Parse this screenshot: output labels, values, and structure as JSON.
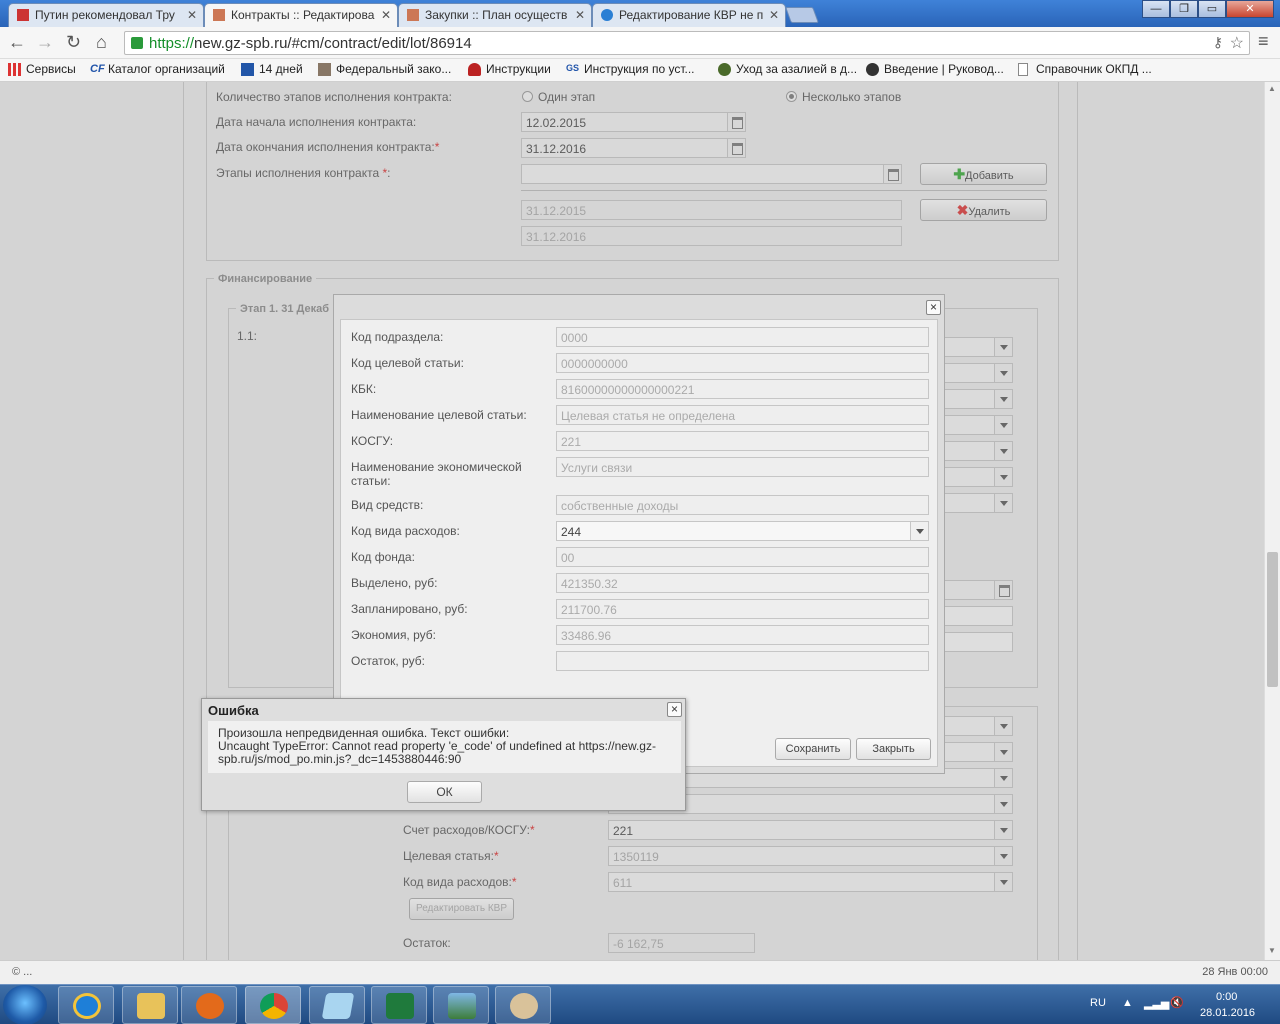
{
  "browser": {
    "tabs": [
      {
        "title": "Путин рекомендовал Тру",
        "favicon": "news-icon",
        "active": false
      },
      {
        "title": "Контракты :: Редактирова",
        "favicon": "tools-icon",
        "active": true
      },
      {
        "title": "Закупки :: План осуществ",
        "favicon": "tools-icon",
        "active": false
      },
      {
        "title": "Редактирование КВР не п",
        "favicon": "help-icon",
        "active": false
      }
    ],
    "url_scheme": "https://",
    "url_rest": "new.gz-spb.ru/#cm/contract/edit/lot/86914",
    "window_buttons": {
      "minimize": "—",
      "maximize": "❐",
      "close": "✕"
    },
    "bookmarks": [
      {
        "label": "Сервисы",
        "icon": "apps-icon"
      },
      {
        "label": "Каталог организаций",
        "icon": "catalog-icon"
      },
      {
        "label": "14 дней",
        "icon": "book-icon"
      },
      {
        "label": "Федеральный зако...",
        "icon": "law-icon"
      },
      {
        "label": "Инструкции",
        "icon": "pin-icon"
      },
      {
        "label": "Инструкция по уст...",
        "icon": "gs-icon"
      },
      {
        "label": "Уход за азалией в д...",
        "icon": "plant-icon"
      },
      {
        "label": "Введение | Руковод...",
        "icon": "g-icon"
      },
      {
        "label": "Справочник ОКПД ...",
        "icon": "page-icon"
      }
    ]
  },
  "contract": {
    "stages_count_label": "Количество этапов исполнения контракта:",
    "stage_option_one": "Один этап",
    "stage_option_many": "Несколько этапов",
    "start_date_label": "Дата начала исполнения контракта:",
    "start_date": "12.02.2015",
    "end_date_label": "Дата окончания исполнения контракта:",
    "end_date": "31.12.2016",
    "stages_label": "Этапы исполнения контракта",
    "stage_dates": [
      "31.12.2015",
      "31.12.2016"
    ],
    "add_button": "Добавить",
    "delete_button": "Удалить",
    "required_mark": "*"
  },
  "financing": {
    "legend": "Финансирование",
    "stage_legend": "Этап 1. 31 Декаб",
    "row_label": "1.1:",
    "lower_fields": [
      {
        "label": "Счет расходов/КОСГУ:",
        "value": "221",
        "enabled": true
      },
      {
        "label": "Целевая статья:",
        "value": "1350119",
        "enabled": false
      },
      {
        "label": "Код вида расходов:",
        "value": "611",
        "enabled": false
      }
    ],
    "edit_kvr_button": "Редактировать КВР",
    "remainder_label": "Остаток:",
    "remainder_value": "-6 162,75"
  },
  "kvr_dialog": {
    "close": "×",
    "fields": [
      {
        "label": "Код подраздела:",
        "value": "0000"
      },
      {
        "label": "Код целевой статьи:",
        "value": "0000000000"
      },
      {
        "label": "КБК:",
        "value": "81600000000000000221"
      },
      {
        "label": "Наименование целевой статьи:",
        "value": "Целевая статья не определена"
      },
      {
        "label": "КОСГУ:",
        "value": "221"
      },
      {
        "label": "Наименование экономической статьи:",
        "value": "Услуги связи"
      },
      {
        "label": "Вид средств:",
        "value": "собственные доходы"
      },
      {
        "label": "Код вида расходов:",
        "value": "244"
      },
      {
        "label": "Код фонда:",
        "value": "00"
      },
      {
        "label": "Выделено, руб:",
        "value": "421350.32"
      },
      {
        "label": "Запланировано, руб:",
        "value": "211700.76"
      },
      {
        "label": "Экономия, руб:",
        "value": "33486.96"
      },
      {
        "label": "Остаток, руб:",
        "value": ""
      }
    ],
    "save_button": "Сохранить",
    "close_button": "Закрыть"
  },
  "error_dialog": {
    "title": "Ошибка",
    "line1": "Произошла непредвиденная ошибка. Текст ошибки:",
    "line2": "Uncaught TypeError: Cannot read property 'e_code' of undefined at https://new.gz-",
    "line3": "spb.ru/js/mod_po.min.js?_dc=1453880446:90",
    "ok_button": "ОК",
    "close": "×"
  },
  "statusbar": {
    "left": "© ...",
    "right": "28 Янв 00:00"
  },
  "taskbar": {
    "apps": [
      "ie-icon",
      "explorer-icon",
      "media-player-icon",
      "chrome-icon",
      "notepad-icon",
      "excel-icon",
      "photos-icon",
      "paint-icon"
    ],
    "lang": "RU",
    "time": "0:00",
    "date": "28.01.2016"
  }
}
